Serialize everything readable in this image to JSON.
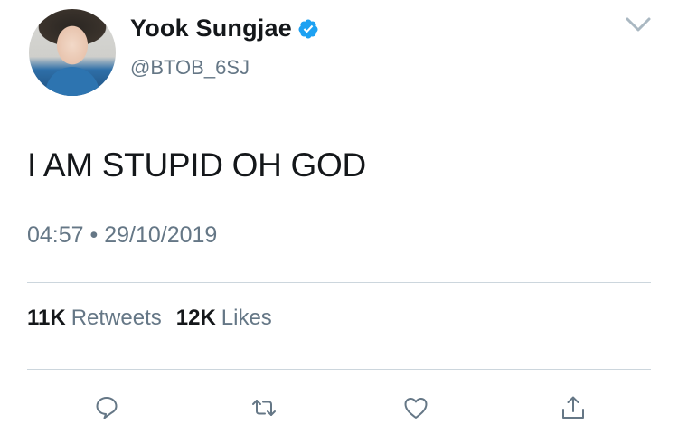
{
  "author": {
    "name": "Yook Sungjae",
    "handle": "@BTOB_6SJ"
  },
  "tweet": {
    "text": "I AM STUPID OH GOD",
    "timestamp": "04:57 • 29/10/2019"
  },
  "stats": {
    "retweets_count": "11K",
    "retweets_label": "Retweets",
    "likes_count": "12K",
    "likes_label": "Likes"
  },
  "colors": {
    "verified_badge": "#1da1f2",
    "secondary_text": "#657786",
    "icon": "#657786"
  },
  "icons": [
    "verified-badge-icon",
    "chevron-down-icon",
    "reply-icon",
    "retweet-icon",
    "like-icon",
    "share-icon"
  ]
}
